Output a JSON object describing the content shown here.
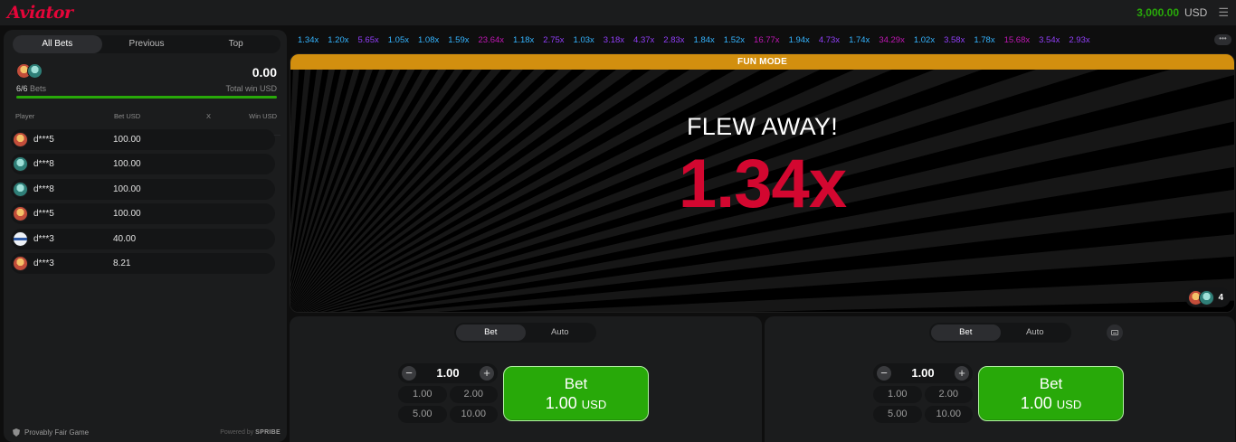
{
  "header": {
    "logo": "Aviator",
    "balance": "3,000.00",
    "currency": "USD",
    "menu_icon": "hamburger-icon"
  },
  "bets_panel": {
    "tabs": [
      {
        "label": "All Bets",
        "active": true
      },
      {
        "label": "Previous",
        "active": false
      },
      {
        "label": "Top",
        "active": false
      }
    ],
    "summary": {
      "bets_count": "6/6",
      "bets_label": "Bets",
      "total_win": "0.00",
      "total_win_label": "Total win USD",
      "progress_fraction": 1.0
    },
    "columns": {
      "player": "Player",
      "bet": "Bet USD",
      "x": "X",
      "win": "Win USD"
    },
    "rows": [
      {
        "player": "d***5",
        "bet": "100.00",
        "avatar": "a1"
      },
      {
        "player": "d***8",
        "bet": "100.00",
        "avatar": "a2"
      },
      {
        "player": "d***8",
        "bet": "100.00",
        "avatar": "a2"
      },
      {
        "player": "d***5",
        "bet": "100.00",
        "avatar": "a1"
      },
      {
        "player": "d***3",
        "bet": "40.00",
        "avatar": "a3"
      },
      {
        "player": "d***3",
        "bet": "8.21",
        "avatar": "a1"
      }
    ],
    "footer": {
      "fair_label": "Provably Fair Game",
      "powered_prefix": "Powered by",
      "powered_brand": "SPRIBE"
    }
  },
  "history": {
    "items": [
      "1.34x",
      "1.20x",
      "5.65x",
      "1.05x",
      "1.08x",
      "1.59x",
      "23.64x",
      "1.18x",
      "2.75x",
      "1.03x",
      "3.18x",
      "4.37x",
      "2.83x",
      "1.84x",
      "1.52x",
      "16.77x",
      "1.94x",
      "4.73x",
      "1.74x",
      "34.29x",
      "1.02x",
      "3.58x",
      "1.78x",
      "15.68x",
      "3.54x",
      "2.93x"
    ],
    "more_label": "•••",
    "colors": {
      "blue": "#34b4ff",
      "purple": "#913ef8",
      "pink": "#c017b4"
    }
  },
  "game": {
    "mode_label": "FUN MODE",
    "status": "FLEW AWAY!",
    "multiplier": "1.34x",
    "players_online": "4",
    "accent_red": "#d30730",
    "mode_color": "#d28f0f"
  },
  "bet_panels": [
    {
      "tabs": [
        {
          "label": "Bet",
          "active": true
        },
        {
          "label": "Auto",
          "active": false
        }
      ],
      "stake": "1.00",
      "quick": [
        "1.00",
        "2.00",
        "5.00",
        "10.00"
      ],
      "button_label": "Bet",
      "button_amount": "1.00",
      "button_currency": "USD"
    },
    {
      "tabs": [
        {
          "label": "Bet",
          "active": true
        },
        {
          "label": "Auto",
          "active": false
        }
      ],
      "stake": "1.00",
      "quick": [
        "1.00",
        "2.00",
        "5.00",
        "10.00"
      ],
      "button_label": "Bet",
      "button_amount": "1.00",
      "button_currency": "USD"
    }
  ]
}
